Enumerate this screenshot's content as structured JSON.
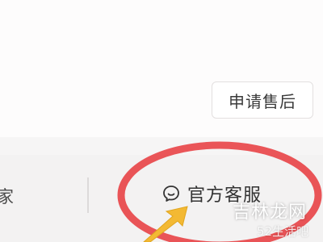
{
  "after_sale": {
    "label": "申请售后"
  },
  "bottom_bar": {
    "contact_seller_label": "家",
    "service_label": "官方客服",
    "service_icon": "chat-bubble-smile-icon"
  },
  "watermark": {
    "text": "吉林龙网",
    "sub": "52生活吧"
  },
  "colors": {
    "circle": "#e8474a",
    "arrow": "#f3b933",
    "text_primary": "#333333"
  }
}
